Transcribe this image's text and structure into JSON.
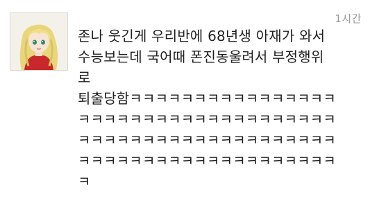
{
  "post": {
    "timestamp": "1시간",
    "avatar_icon": "anime-girl-avatar",
    "lines": [
      "존나 웃긴게 우리반에 68년생 아재가 와서",
      "수능보는데 국어때 폰진동울려서 부정행위",
      "로",
      "퇴출당함ㅋㅋㅋㅋㅋㅋㅋㅋㅋㅋㅋㅋㅋㅋㅋㅋ",
      "ㅋㅋㅋㅋㅋㅋㅋㅋㅋㅋㅋㅋㅋㅋㅋㅋㅋㅋㅋㅋ",
      "ㅋㅋㅋㅋㅋㅋㅋㅋㅋㅋㅋㅋㅋㅋㅋㅋㅋㅋㅋㅋ",
      "ㅋㅋㅋㅋㅋㅋㅋㅋㅋㅋㅋㅋㅋㅋㅋㅋㅋㅋㅋㅋ",
      "ㅋ"
    ]
  },
  "colors": {
    "text": "#1f1f1f",
    "timestamp": "#9a9a9a",
    "background": "#ffffff"
  }
}
